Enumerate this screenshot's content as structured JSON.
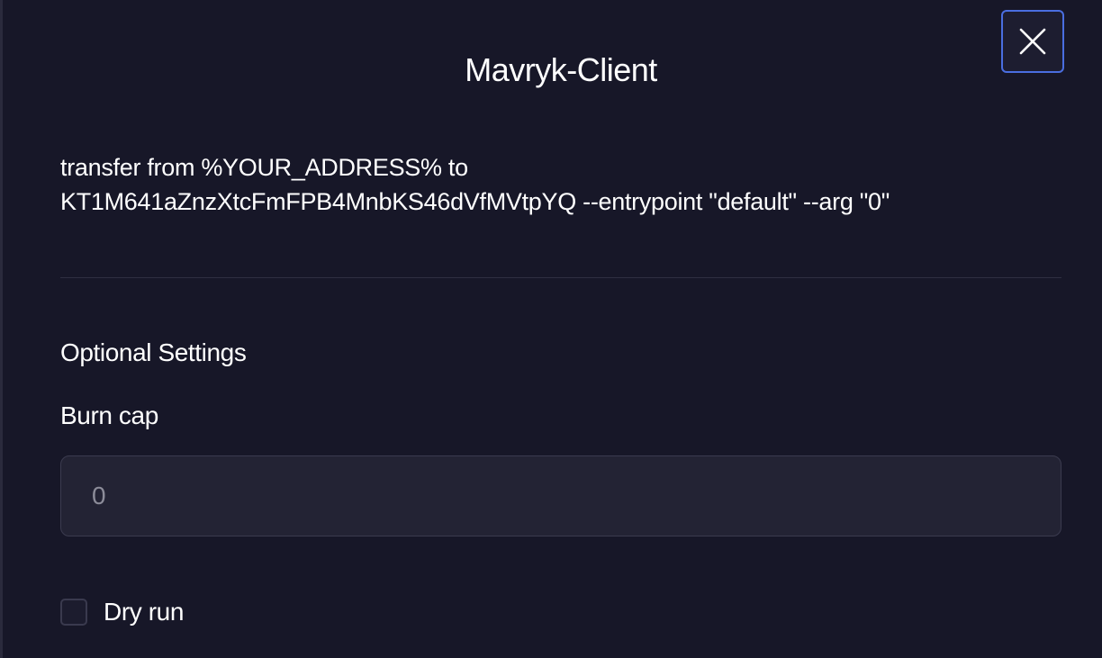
{
  "modal": {
    "title": "Mavryk-Client",
    "close_icon": "close-icon",
    "command": {
      "line1": "transfer from %YOUR_ADDRESS% to",
      "line2": "KT1M641aZnzXtcFmFPB4MnbKS46dVfMVtpYQ --entrypoint \"default\" --arg \"0\""
    },
    "optional_settings": {
      "heading": "Optional Settings",
      "burn_cap": {
        "label": "Burn cap",
        "value": "",
        "placeholder": "0"
      },
      "dry_run": {
        "label": "Dry run",
        "checked": false
      }
    },
    "colors": {
      "background": "#171728",
      "accent_border": "#4a6ee0",
      "input_background": "#232334"
    }
  }
}
